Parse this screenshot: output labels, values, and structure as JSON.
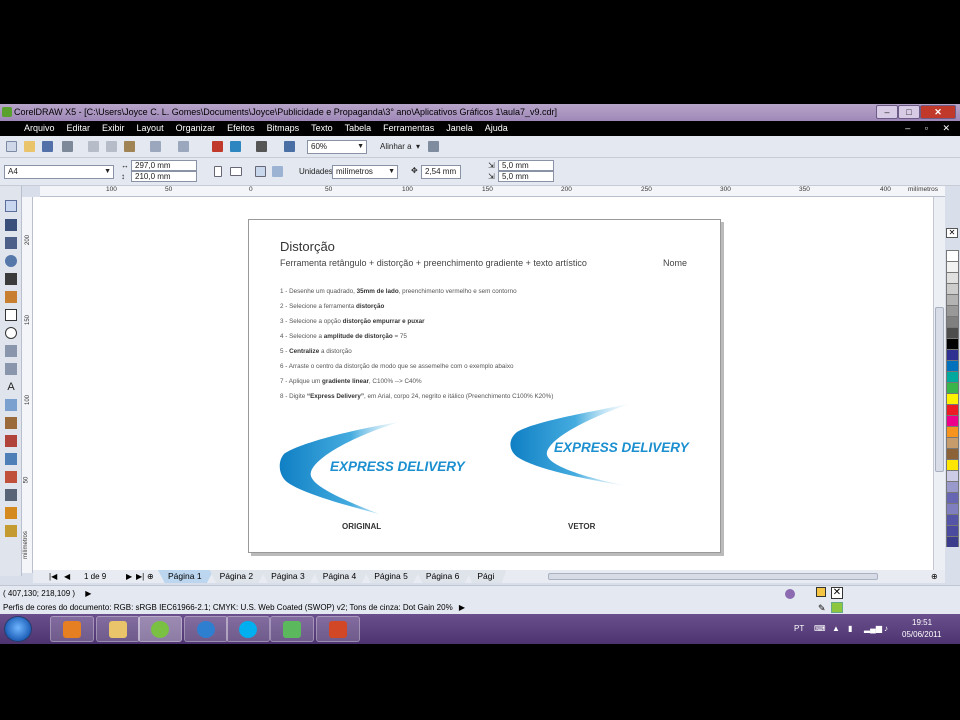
{
  "window": {
    "title": "CorelDRAW X5 - [C:\\Users\\Joyce C. L. Gomes\\Documents\\Joyce\\Publicidade e Propaganda\\3° ano\\Aplicativos Gráficos 1\\aula7_v9.cdr]",
    "min": "–",
    "max": "□",
    "close": "✕"
  },
  "menu": {
    "items": [
      "Arquivo",
      "Editar",
      "Exibir",
      "Layout",
      "Organizar",
      "Efeitos",
      "Bitmaps",
      "Texto",
      "Tabela",
      "Ferramentas",
      "Janela",
      "Ajuda"
    ],
    "mdi": "– ▫ ✕"
  },
  "toolbar1": {
    "zoom": "60%",
    "snap_label": "Alinhar a"
  },
  "toolbar2": {
    "paper": "A4",
    "width": "297,0 mm",
    "height": "210,0 mm",
    "units_label": "Unidades:",
    "units": "milímetros",
    "nudge": "2,54 mm",
    "dup_x": "5,0 mm",
    "dup_y": "5,0 mm"
  },
  "ruler": {
    "h_ticks": [
      "100",
      "50",
      "0",
      "50",
      "100",
      "150",
      "200",
      "250",
      "300",
      "350",
      "400"
    ],
    "h_unit": "milímetros",
    "v_ticks": [
      "200",
      "150",
      "100",
      "50"
    ],
    "v_unit": "milímetros"
  },
  "page": {
    "title": "Distorção",
    "subtitle": "Ferramenta retângulo + distorção + preenchimento gradiente + texto artístico",
    "name_label": "Nome",
    "steps": [
      {
        "pre": "1 - Desenhe um quadrado, ",
        "bold": "35mm de lado",
        "post": ", preenchimento vermelho e sem contorno"
      },
      {
        "pre": "2 - Selecione a ferramenta ",
        "bold": "distorção",
        "post": ""
      },
      {
        "pre": "3 - Selecione a opção ",
        "bold": "distorção empurrar e puxar",
        "post": ""
      },
      {
        "pre": "4 - Selecione a ",
        "bold": "amplitude de distorção",
        "post": " = 75"
      },
      {
        "pre": "5 - ",
        "bold": "Centralize",
        "post": " a distorção"
      },
      {
        "pre": "6 - Arraste o centro da distorção de modo que se assemelhe com o exemplo abaixo",
        "bold": "",
        "post": ""
      },
      {
        "pre": "7 - Aplique um ",
        "bold": "gradiente linear",
        "post": ", C100% --> C40%"
      },
      {
        "pre": "8 - Digite ",
        "bold": "“Express Delivery”",
        "post": ", em Arial, corpo 24, negrito e itálico (Preenchimento C100% K20%)"
      }
    ],
    "logo_text": "EXPRESS DELIVERY",
    "caption_original": "ORIGINAL",
    "caption_vetor": "VETOR"
  },
  "pagebar": {
    "counter": "1 de 9",
    "tabs": [
      "Página 1",
      "Página 2",
      "Página 3",
      "Página 4",
      "Página 5",
      "Página 6",
      "Pági"
    ]
  },
  "status": {
    "coords": "( 407,130; 218,109 )",
    "color_profile": "Perfis de cores do documento: RGB: sRGB IEC61966-2.1; CMYK: U.S. Web Coated (SWOP) v2; Tons de cinza: Dot Gain 20%"
  },
  "taskbar": {
    "lang": "PT",
    "time": "19:51",
    "date": "05/06/2011"
  },
  "colors": {
    "accent": "#1b8fcf",
    "titlebar": "#a892c0",
    "taskbar": "#5a3f7e"
  },
  "palette": [
    "#ffffff",
    "#f2f2f2",
    "#e0e0e0",
    "#cccccc",
    "#b3b3b3",
    "#999999",
    "#808080",
    "#4d4d4d",
    "#000000",
    "#2e3192",
    "#0071bc",
    "#00a99d",
    "#39b54a",
    "#fff200",
    "#ed1c24",
    "#ec008c",
    "#f7941d",
    "#c69c6d",
    "#8c6239",
    "#ffe600",
    "#cccce6",
    "#9999cc",
    "#6666b3",
    "#7f7fbf",
    "#5555a8",
    "#4a4a9e",
    "#3c3c8c"
  ]
}
